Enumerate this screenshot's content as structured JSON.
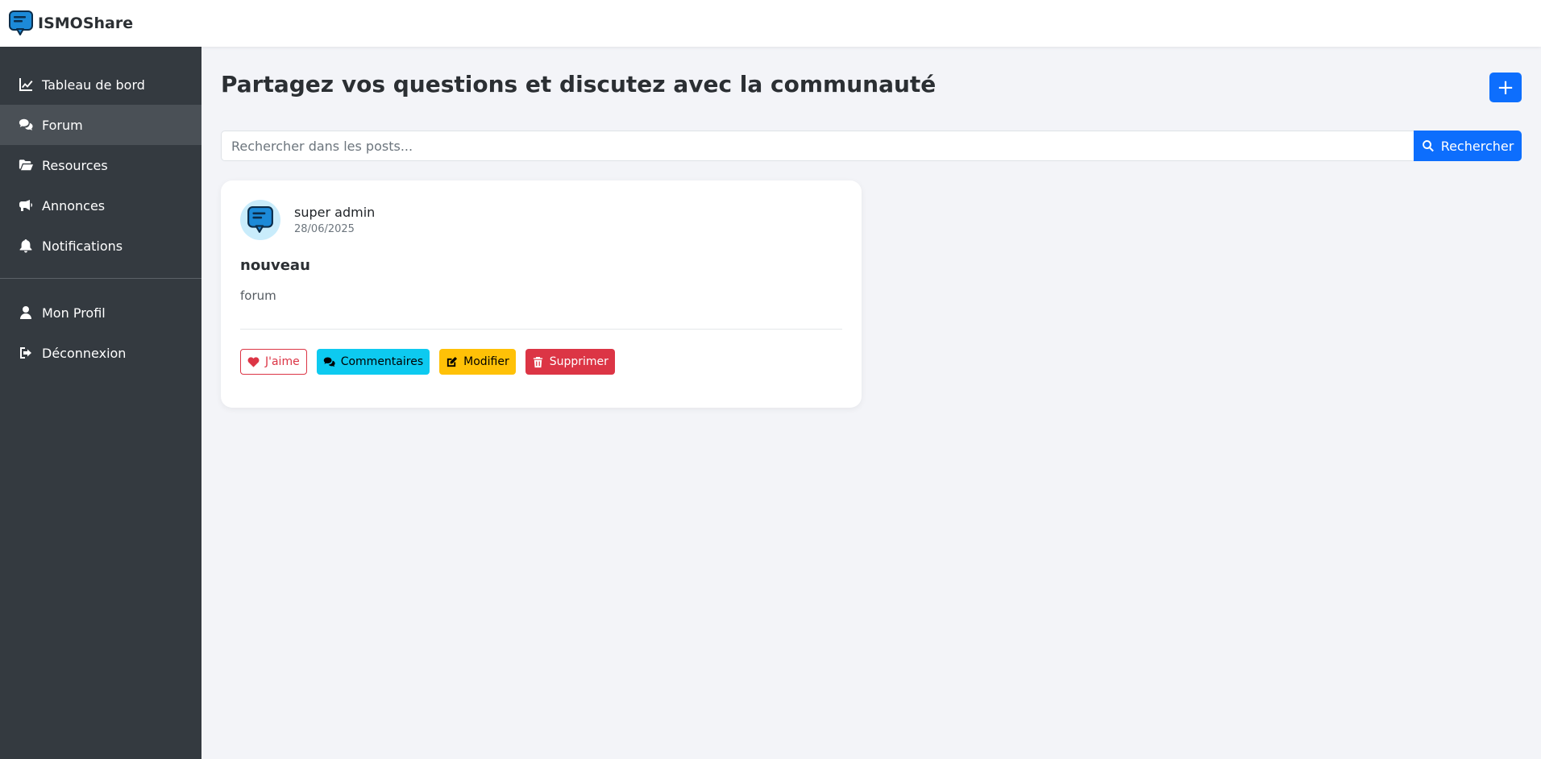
{
  "brand": {
    "name": "ISMOShare",
    "logo_icon": "chat-bubble-icon"
  },
  "sidebar": {
    "items": [
      {
        "label": "Tableau de bord",
        "icon": "chart-line-icon",
        "active": false
      },
      {
        "label": "Forum",
        "icon": "comments-icon",
        "active": true
      },
      {
        "label": "Resources",
        "icon": "folder-open-icon",
        "active": false
      },
      {
        "label": "Annonces",
        "icon": "megaphone-icon",
        "active": false
      },
      {
        "label": "Notifications",
        "icon": "bell-icon",
        "active": false
      }
    ],
    "bottom_items": [
      {
        "label": "Mon Profil",
        "icon": "user-icon"
      },
      {
        "label": "Déconnexion",
        "icon": "sign-out-icon"
      }
    ]
  },
  "main": {
    "title": "Partagez vos questions et discutez avec la communauté",
    "add_button_label": "+",
    "search": {
      "placeholder": "Rechercher dans les posts...",
      "value": "",
      "button_label": "Rechercher"
    }
  },
  "posts": [
    {
      "author": "super admin",
      "date": "28/06/2025",
      "title": "nouveau",
      "body": "forum",
      "actions": {
        "like": "J'aime",
        "comments": "Commentaires",
        "edit": "Modifier",
        "delete": "Supprimer"
      }
    }
  ],
  "colors": {
    "sidebar_bg": "#343a40",
    "sidebar_active": "#4a5056",
    "primary": "#0d6efd",
    "info": "#0dcaf0",
    "warning": "#ffc107",
    "danger": "#dc3545",
    "page_bg": "#f3f4f8"
  }
}
